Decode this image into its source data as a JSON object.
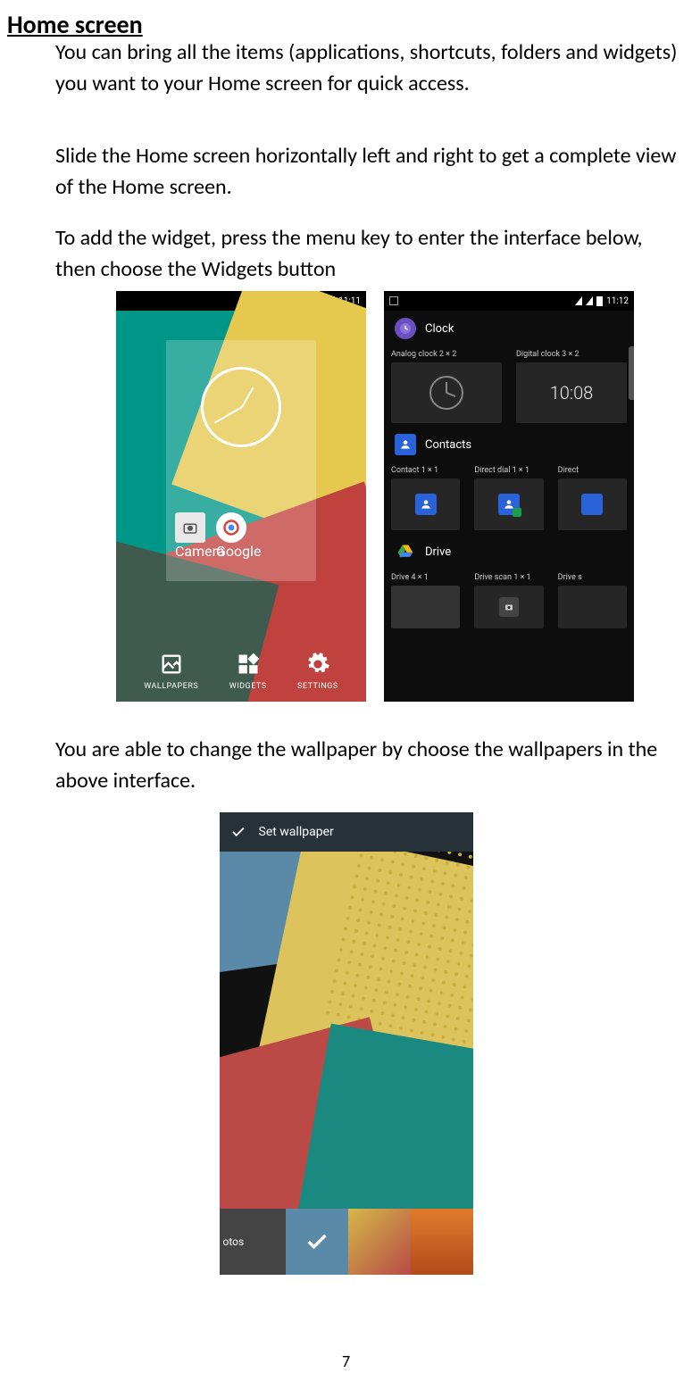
{
  "title": "Home screen",
  "para1": "You can bring all the items (applications, shortcuts, folders and widgets) you want to your Home screen for quick access.",
  "para2": "Slide the Home screen horizontally left and right to get a complete view of the Home screen.",
  "para3": "To add the widget, press the menu key to enter the interface below, then choose the Widgets button",
  "para4": "You are able to change the wallpaper by choose the wallpapers in the above interface.",
  "page_number": "7",
  "left_phone": {
    "time": "11:11",
    "apps": [
      {
        "label": "Camera"
      },
      {
        "label": "Google"
      }
    ],
    "buttons": {
      "wallpapers": "WALLPAPERS",
      "widgets": "WIDGETS",
      "settings": "SETTINGS"
    }
  },
  "right_phone": {
    "time": "11:12",
    "categories": [
      {
        "name": "Clock",
        "widgets": [
          {
            "label": "Analog clock  2 × 2"
          },
          {
            "label": "Digital clock  3 × 2",
            "preview_time": "10:08"
          }
        ]
      },
      {
        "name": "Contacts",
        "widgets": [
          {
            "label": "Contact  1 × 1"
          },
          {
            "label": "Direct dial  1 × 1"
          },
          {
            "label": "Direct"
          }
        ]
      },
      {
        "name": "Drive",
        "widgets": [
          {
            "label": "Drive  4 × 1"
          },
          {
            "label": "Drive scan  1 × 1"
          },
          {
            "label": "Drive s"
          }
        ]
      }
    ]
  },
  "bottom_phone": {
    "header": "Set wallpaper",
    "thumbs": {
      "otos": "otos"
    }
  }
}
